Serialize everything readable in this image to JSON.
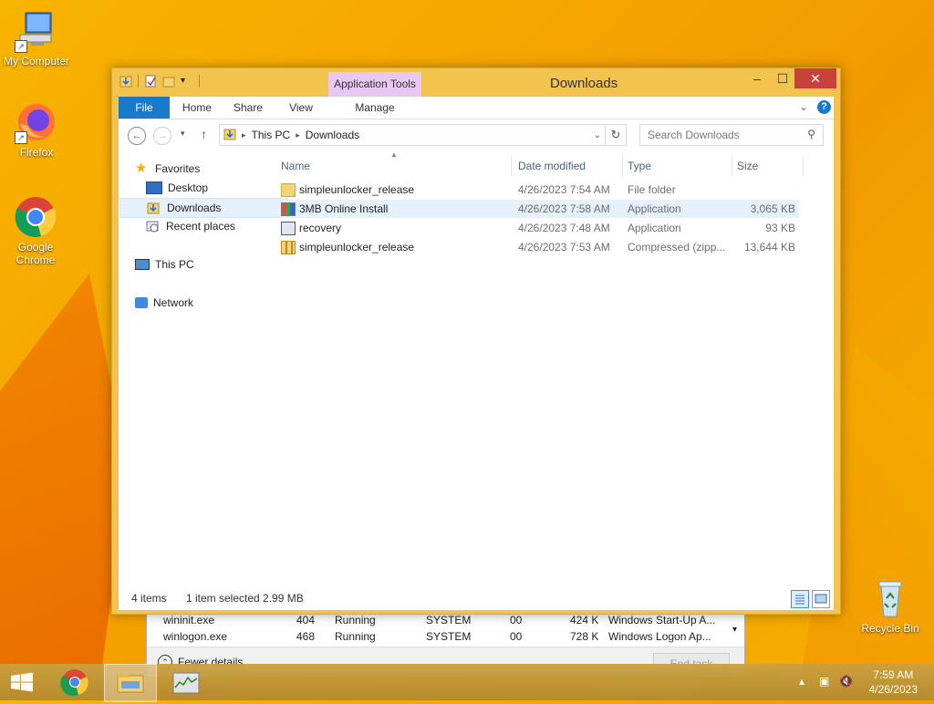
{
  "desktop": {
    "icons": [
      {
        "label": "My Computer"
      },
      {
        "label": "Firefox"
      },
      {
        "label": "Google Chrome"
      },
      {
        "label": "Recycle Bin"
      }
    ]
  },
  "window": {
    "title": "Downloads",
    "context_tab_group": "Application Tools",
    "ribbon_tabs": [
      "File",
      "Home",
      "Share",
      "View",
      "Manage"
    ],
    "controls": {
      "minimize": "–",
      "maximize": "☐",
      "close": "✕"
    }
  },
  "navbar": {
    "breadcrumb": [
      "This PC",
      "Downloads"
    ],
    "search_placeholder": "Search Downloads"
  },
  "navpane": {
    "favorites": "Favorites",
    "desktop": "Desktop",
    "downloads": "Downloads",
    "recent": "Recent places",
    "thispc": "This PC",
    "network": "Network"
  },
  "filelist": {
    "columns": [
      "Name",
      "Date modified",
      "Type",
      "Size"
    ],
    "rows": [
      {
        "name": "simpleunlocker_release",
        "date": "4/26/2023 7:54 AM",
        "type": "File folder",
        "size": "",
        "icon": "folder-icon"
      },
      {
        "name": "3MB Online Install",
        "date": "4/26/2023 7:58 AM",
        "type": "Application",
        "size": "3,065 KB",
        "icon": "installer-icon"
      },
      {
        "name": "recovery",
        "date": "4/26/2023 7:48 AM",
        "type": "Application",
        "size": "93 KB",
        "icon": "application-icon"
      },
      {
        "name": "simpleunlocker_release",
        "date": "4/26/2023 7:53 AM",
        "type": "Compressed (zipp...",
        "size": "13,644 KB",
        "icon": "zip-icon"
      }
    ]
  },
  "status": {
    "count": "4 items",
    "selection": "1 item selected  2.99 MB"
  },
  "taskmgr": {
    "rows": [
      {
        "name": "wininit.exe",
        "pid": "404",
        "status": "Running",
        "user": "SYSTEM",
        "cpu": "00",
        "mem": "424 K",
        "desc": "Windows Start-Up A..."
      },
      {
        "name": "winlogon.exe",
        "pid": "468",
        "status": "Running",
        "user": "SYSTEM",
        "cpu": "00",
        "mem": "728 K",
        "desc": "Windows Logon Ap..."
      }
    ],
    "fewer_details": "Fewer details",
    "end_task": "End task"
  },
  "taskbar": {
    "time": "7:59 AM",
    "date": "4/26/2023"
  }
}
